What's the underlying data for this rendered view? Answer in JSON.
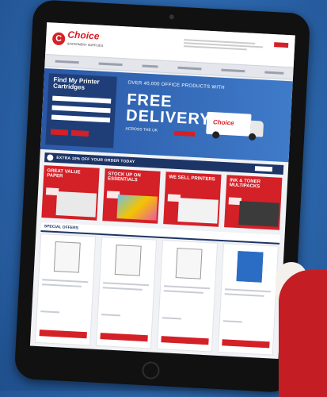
{
  "header": {
    "logo_mark": "C",
    "logo_name": "Choice",
    "logo_tagline": "STATIONERY SUPPLIES"
  },
  "hero": {
    "finder_title": "Find My Printer Cartridges",
    "promo_top": "OVER 40,000 OFFICE PRODUCTS WITH",
    "free_delivery": "FREE DELIVERY",
    "across": "ACROSS THE UK",
    "van_logo": "Choice"
  },
  "offer_bar": {
    "text": "EXTRA 10% OFF YOUR ORDER TODAY"
  },
  "tiles": [
    {
      "label": "GREAT VALUE PAPER",
      "color": "#d42027",
      "visual": "#e9e9e9"
    },
    {
      "label": "STOCK UP ON ESSENTIALS",
      "color": "#d42027",
      "visual": "#6ec0e8"
    },
    {
      "label": "WE SELL PRINTERS",
      "color": "#d42027",
      "visual": "#f2f2f2"
    },
    {
      "label": "INK & TONER MULTIPACKS",
      "color": "#d42027",
      "visual": "#3b3b3b"
    }
  ],
  "special": {
    "title": "SPECIAL OFFERS"
  },
  "colors": {
    "brand_red": "#d42027",
    "navy": "#1d3566",
    "background_blue": "#2a63a8"
  }
}
